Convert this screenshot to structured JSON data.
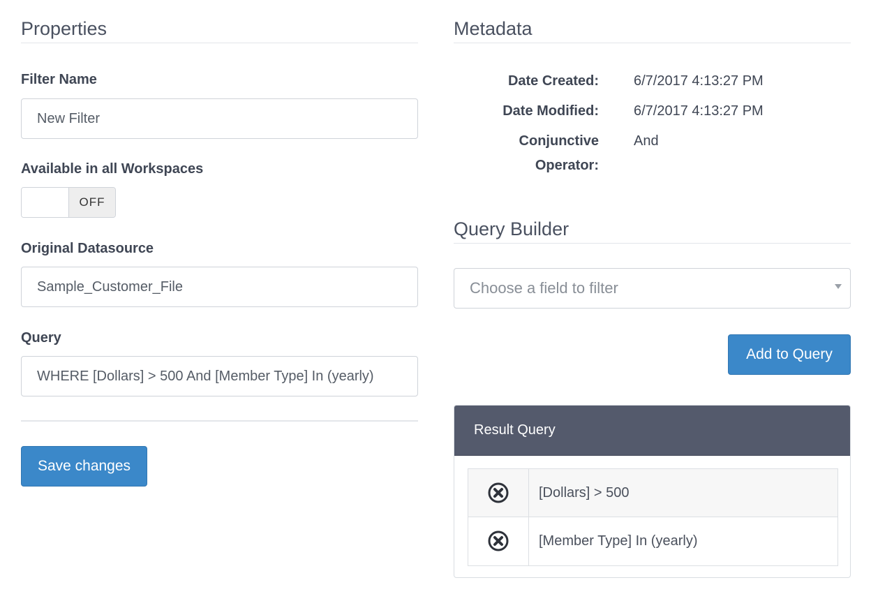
{
  "properties": {
    "title": "Properties",
    "filter_name_label": "Filter Name",
    "filter_name_value": "New Filter",
    "workspaces_label": "Available in all Workspaces",
    "workspaces_toggle": "OFF",
    "datasource_label": "Original Datasource",
    "datasource_value": "Sample_Customer_File",
    "query_label": "Query",
    "query_value": "WHERE [Dollars] > 500 And [Member Type] In (yearly)",
    "save_label": "Save changes"
  },
  "metadata": {
    "title": "Metadata",
    "date_created_label": "Date Created:",
    "date_created_value": "6/7/2017 4:13:27 PM",
    "date_modified_label": "Date Modified:",
    "date_modified_value": "6/7/2017 4:13:27 PM",
    "conjunctive_label_line1": "Conjunctive",
    "conjunctive_label_line2": "Operator:",
    "conjunctive_value": "And"
  },
  "query_builder": {
    "title": "Query Builder",
    "field_placeholder": "Choose a field to filter",
    "add_label": "Add to Query"
  },
  "result_query": {
    "title": "Result Query",
    "items": [
      {
        "text": "[Dollars] > 500",
        "icon": "remove-circle-icon"
      },
      {
        "text": "[Member Type] In (yearly)",
        "icon": "remove-circle-icon"
      }
    ]
  },
  "colors": {
    "primary_button": "#3b88c9",
    "panel_header": "#545a6c",
    "section_title": "#4a5160"
  }
}
